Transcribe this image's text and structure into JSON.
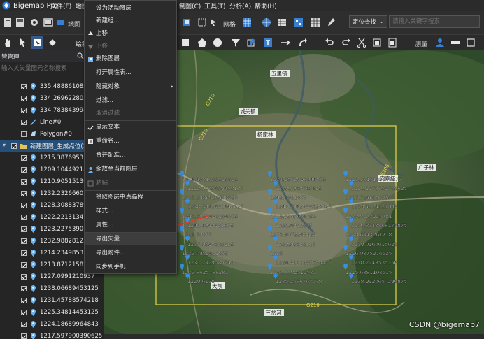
{
  "app": {
    "title": "Bigemap Pro"
  },
  "menu": {
    "items": [
      "文件(F)",
      "地图",
      "制图(C)",
      "工具(T)",
      "分析(A)",
      "帮助(H)"
    ]
  },
  "toolbar": {
    "label_map": "地图",
    "label_grid": "网格",
    "label_measure": "测量",
    "label_draw": "绘制",
    "locate_select": "定位查找",
    "search_placeholder": "请输入关键字搜索"
  },
  "panel": {
    "header": "管管理",
    "search_placeholder": "输入关矢量图元名称搜索",
    "layers": [
      {
        "label": "335.48886108390",
        "checked": true,
        "icon": "point-icon"
      },
      {
        "label": "334.2696228027",
        "checked": true,
        "icon": "point-icon"
      },
      {
        "label": "334.7838439941",
        "checked": true,
        "icon": "point-icon"
      },
      {
        "label": "Line#0",
        "checked": true,
        "icon": "line-icon"
      },
      {
        "label": "Polygon#0",
        "checked": false,
        "icon": "polygon-icon"
      },
      {
        "label": "新建图层_生成点位(1",
        "checked": true,
        "icon": "folder-icon",
        "selected": true
      },
      {
        "label": "1215.3876953125",
        "checked": true,
        "icon": "point-icon"
      },
      {
        "label": "1209.1044921875",
        "checked": true,
        "icon": "point-icon"
      },
      {
        "label": "1210.9051513671",
        "checked": true,
        "icon": "point-icon"
      },
      {
        "label": "1232.2326660156",
        "checked": true,
        "icon": "point-icon"
      },
      {
        "label": "1228.3088378906",
        "checked": true,
        "icon": "point-icon"
      },
      {
        "label": "1222.2213134765",
        "checked": true,
        "icon": "point-icon"
      },
      {
        "label": "1223.2275390625",
        "checked": true,
        "icon": "point-icon"
      },
      {
        "label": "1232.98828125",
        "checked": true,
        "icon": "point-icon"
      },
      {
        "label": "1214.2349853515",
        "checked": true,
        "icon": "point-icon"
      },
      {
        "label": "1213.8712158203",
        "checked": true,
        "icon": "point-icon"
      },
      {
        "label": "1227.0991210937",
        "checked": true,
        "icon": "point-icon"
      },
      {
        "label": "1238.06689453125",
        "checked": true,
        "icon": "point-icon"
      },
      {
        "label": "1231.45788574218",
        "checked": true,
        "icon": "point-icon"
      },
      {
        "label": "1225.34814453125",
        "checked": true,
        "icon": "point-icon"
      },
      {
        "label": "1224.18689964843",
        "checked": true,
        "icon": "point-icon"
      },
      {
        "label": "1217.597900390625",
        "checked": true,
        "icon": "point-icon"
      }
    ]
  },
  "context_menu": {
    "items": [
      {
        "label": "设为活动图层",
        "disabled": false
      },
      {
        "label": "新建组...",
        "disabled": false
      },
      {
        "label": "上移",
        "disabled": false,
        "icon": "move-up-icon"
      },
      {
        "label": "下移",
        "disabled": true,
        "icon": "move-down-icon"
      },
      {
        "label": "删除图层",
        "disabled": false,
        "icon": "delete-icon"
      },
      {
        "label": "打开属性表...",
        "disabled": false
      },
      {
        "label": "隐藏对象",
        "disabled": false,
        "submenu": true
      },
      {
        "label": "过滤...",
        "disabled": false
      },
      {
        "label": "取消过滤",
        "disabled": true
      },
      {
        "label": "显示文本",
        "disabled": false,
        "icon": "check-icon"
      },
      {
        "label": "重命名...",
        "disabled": false,
        "icon": "rename-icon"
      },
      {
        "label": "合并配准...",
        "disabled": false
      },
      {
        "label": "缩放至当前图层",
        "disabled": false,
        "icon": "zoom-layer-icon"
      },
      {
        "label": "粘贴",
        "disabled": true,
        "icon": "paste-icon"
      },
      {
        "label": "拾取图层中点高程",
        "disabled": false
      },
      {
        "label": "样式...",
        "disabled": false
      },
      {
        "label": "属性...",
        "disabled": false
      },
      {
        "label": "导出矢量",
        "disabled": false,
        "hover": true
      },
      {
        "label": "导出附件...",
        "disabled": false
      },
      {
        "label": "同步到手机",
        "disabled": false
      }
    ]
  },
  "map": {
    "place_labels": [
      "五里镇",
      "城关镇",
      "杨家林",
      "安家垭",
      "广子林",
      "三岔河",
      "大坝"
    ],
    "elevation_labels": [
      "1216.4381103515625",
      "1234.1572998046875",
      "1211.1815185546875",
      "1222.1075439453125",
      "1239.1009765625",
      "1220.1978759765625",
      "1223.2036910400625",
      "1242.9921875",
      "1217.724609375",
      "1230.5992431640625",
      "1240.7062988828125",
      "1239.4224121093",
      "1240.0052490234375",
      "1213.1347656250",
      "1233.8273925781",
      "1241.6044921875",
      "1231.4921875",
      "1236.8343868171875",
      "1229.59375",
      "1278.9072265625",
      "1239.6843261718",
      "1237.9598828125",
      "1232.98828125",
      "1239.0160015625",
      "1233.6982421875",
      "1225",
      "1216.0375976525",
      "1231.2829589843",
      "1224.3101255859375",
      "1210.2248535156",
      "1233.8625488281",
      "1230.7082519531",
      "1215.6881103515",
      "1229.6130",
      "1235.2686767578",
      "1238.9920654296875"
    ]
  },
  "watermark": "CSDN @bigemap7",
  "colors": {
    "accent": "#264f78",
    "selection_box": "#e8d44d",
    "arrow": "#e03a2a",
    "pin": "#3b8fe0"
  }
}
